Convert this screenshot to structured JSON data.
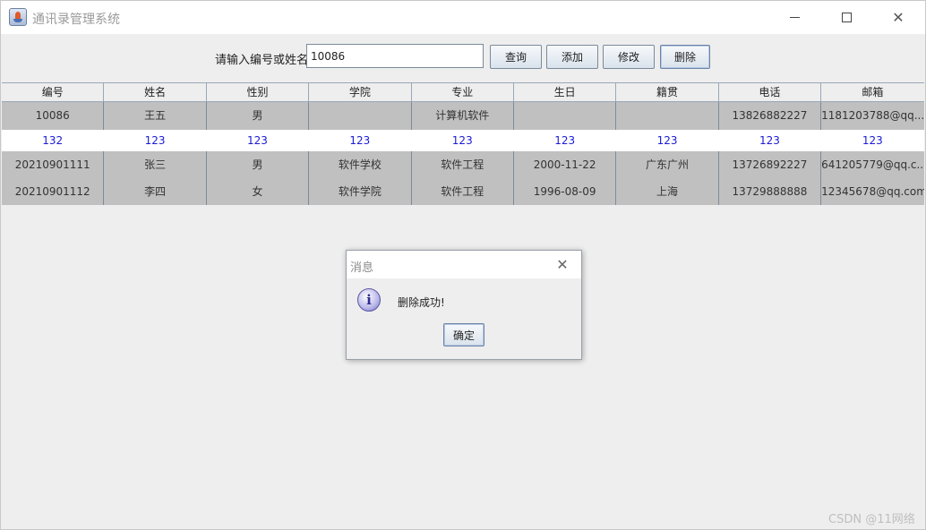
{
  "window": {
    "title": "通讯录管理系统",
    "minimize_icon": "minimize-icon",
    "maximize_icon": "maximize-icon",
    "close_glyph": "✕"
  },
  "toolbar": {
    "search_label": "请输入编号或姓名",
    "search_value": "10086",
    "query_label": "查询",
    "add_label": "添加",
    "edit_label": "修改",
    "delete_label": "删除"
  },
  "table": {
    "columns": [
      "编号",
      "姓名",
      "性别",
      "学院",
      "专业",
      "生日",
      "籍贯",
      "电话",
      "邮箱"
    ],
    "rows": [
      [
        "10086",
        "王五",
        "男",
        "",
        "计算机软件",
        "",
        "",
        "13826882227",
        "1181203788@qq...."
      ],
      [
        "132",
        "123",
        "123",
        "123",
        "123",
        "123",
        "123",
        "123",
        "123"
      ],
      [
        "20210901111",
        "张三",
        "男",
        "软件学校",
        "软件工程",
        "2000-11-22",
        "广东广州",
        "13726892227",
        "641205779@qq.c..."
      ],
      [
        "20210901112",
        "李四",
        "女",
        "软件学院",
        "软件工程",
        "1996-08-09",
        "上海",
        "13729888888",
        "12345678@qq.com"
      ]
    ]
  },
  "dialog": {
    "title": "消息",
    "close_glyph": "✕",
    "icon_glyph": "i",
    "message": "删除成功!",
    "ok_label": "确定"
  },
  "watermark": "CSDN @11网络"
}
